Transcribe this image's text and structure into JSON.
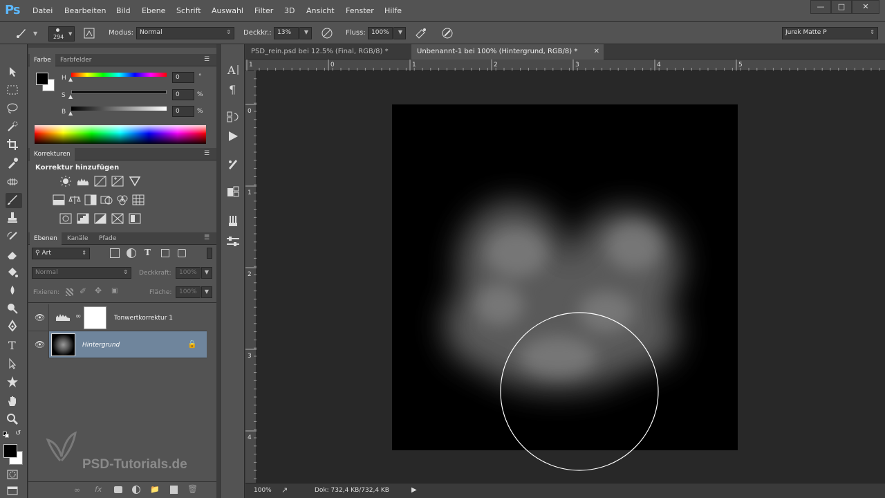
{
  "app": {
    "logo": "Ps"
  },
  "menu": [
    "Datei",
    "Bearbeiten",
    "Bild",
    "Ebene",
    "Schrift",
    "Auswahl",
    "Filter",
    "3D",
    "Ansicht",
    "Fenster",
    "Hilfe"
  ],
  "options": {
    "brush_size": "294",
    "mode_label": "Modus:",
    "mode_value": "Normal",
    "opacity_label": "Deckkr.:",
    "opacity_value": "13%",
    "flow_label": "Fluss:",
    "flow_value": "100%",
    "workspace": "Jurek Matte P"
  },
  "color_panel": {
    "tabs": [
      "Farbe",
      "Farbfelder"
    ],
    "h_label": "H",
    "h_value": "0",
    "h_unit": "°",
    "s_label": "S",
    "s_value": "0",
    "s_unit": "%",
    "b_label": "B",
    "b_value": "0",
    "b_unit": "%"
  },
  "adjustments_panel": {
    "tab": "Korrekturen",
    "heading": "Korrektur hinzufügen"
  },
  "layers_panel": {
    "tabs": [
      "Ebenen",
      "Kanäle",
      "Pfade"
    ],
    "filter_kind": "Art",
    "blend_mode": "Normal",
    "opacity_label": "Deckkraft:",
    "opacity_value": "100%",
    "lock_label": "Fixieren:",
    "fill_label": "Fläche:",
    "fill_value": "100%",
    "layers": [
      {
        "name": "Tonwertkorrektur 1"
      },
      {
        "name": "Hintergrund"
      }
    ]
  },
  "documents": {
    "tabs": [
      {
        "title": "PSD_rein.psd bei 12.5% (Final, RGB/8) *"
      },
      {
        "title": "Unbenannt-1 bei 100% (Hintergrund, RGB/8) *"
      }
    ]
  },
  "rulers": {
    "h_ticks": [
      "1",
      "0",
      "1",
      "2",
      "3",
      "4",
      "5"
    ],
    "v_ticks": [
      "0",
      "1",
      "2",
      "3",
      "4"
    ]
  },
  "status": {
    "zoom": "100%",
    "doc_info": "Dok: 732,4 KB/732,4 KB"
  },
  "watermark": "PSD-Tutorials.de",
  "colors": {
    "foreground": "#000000",
    "background": "#ffffff",
    "selected_layer": "#6f859c",
    "ui_panel": "#535353"
  }
}
